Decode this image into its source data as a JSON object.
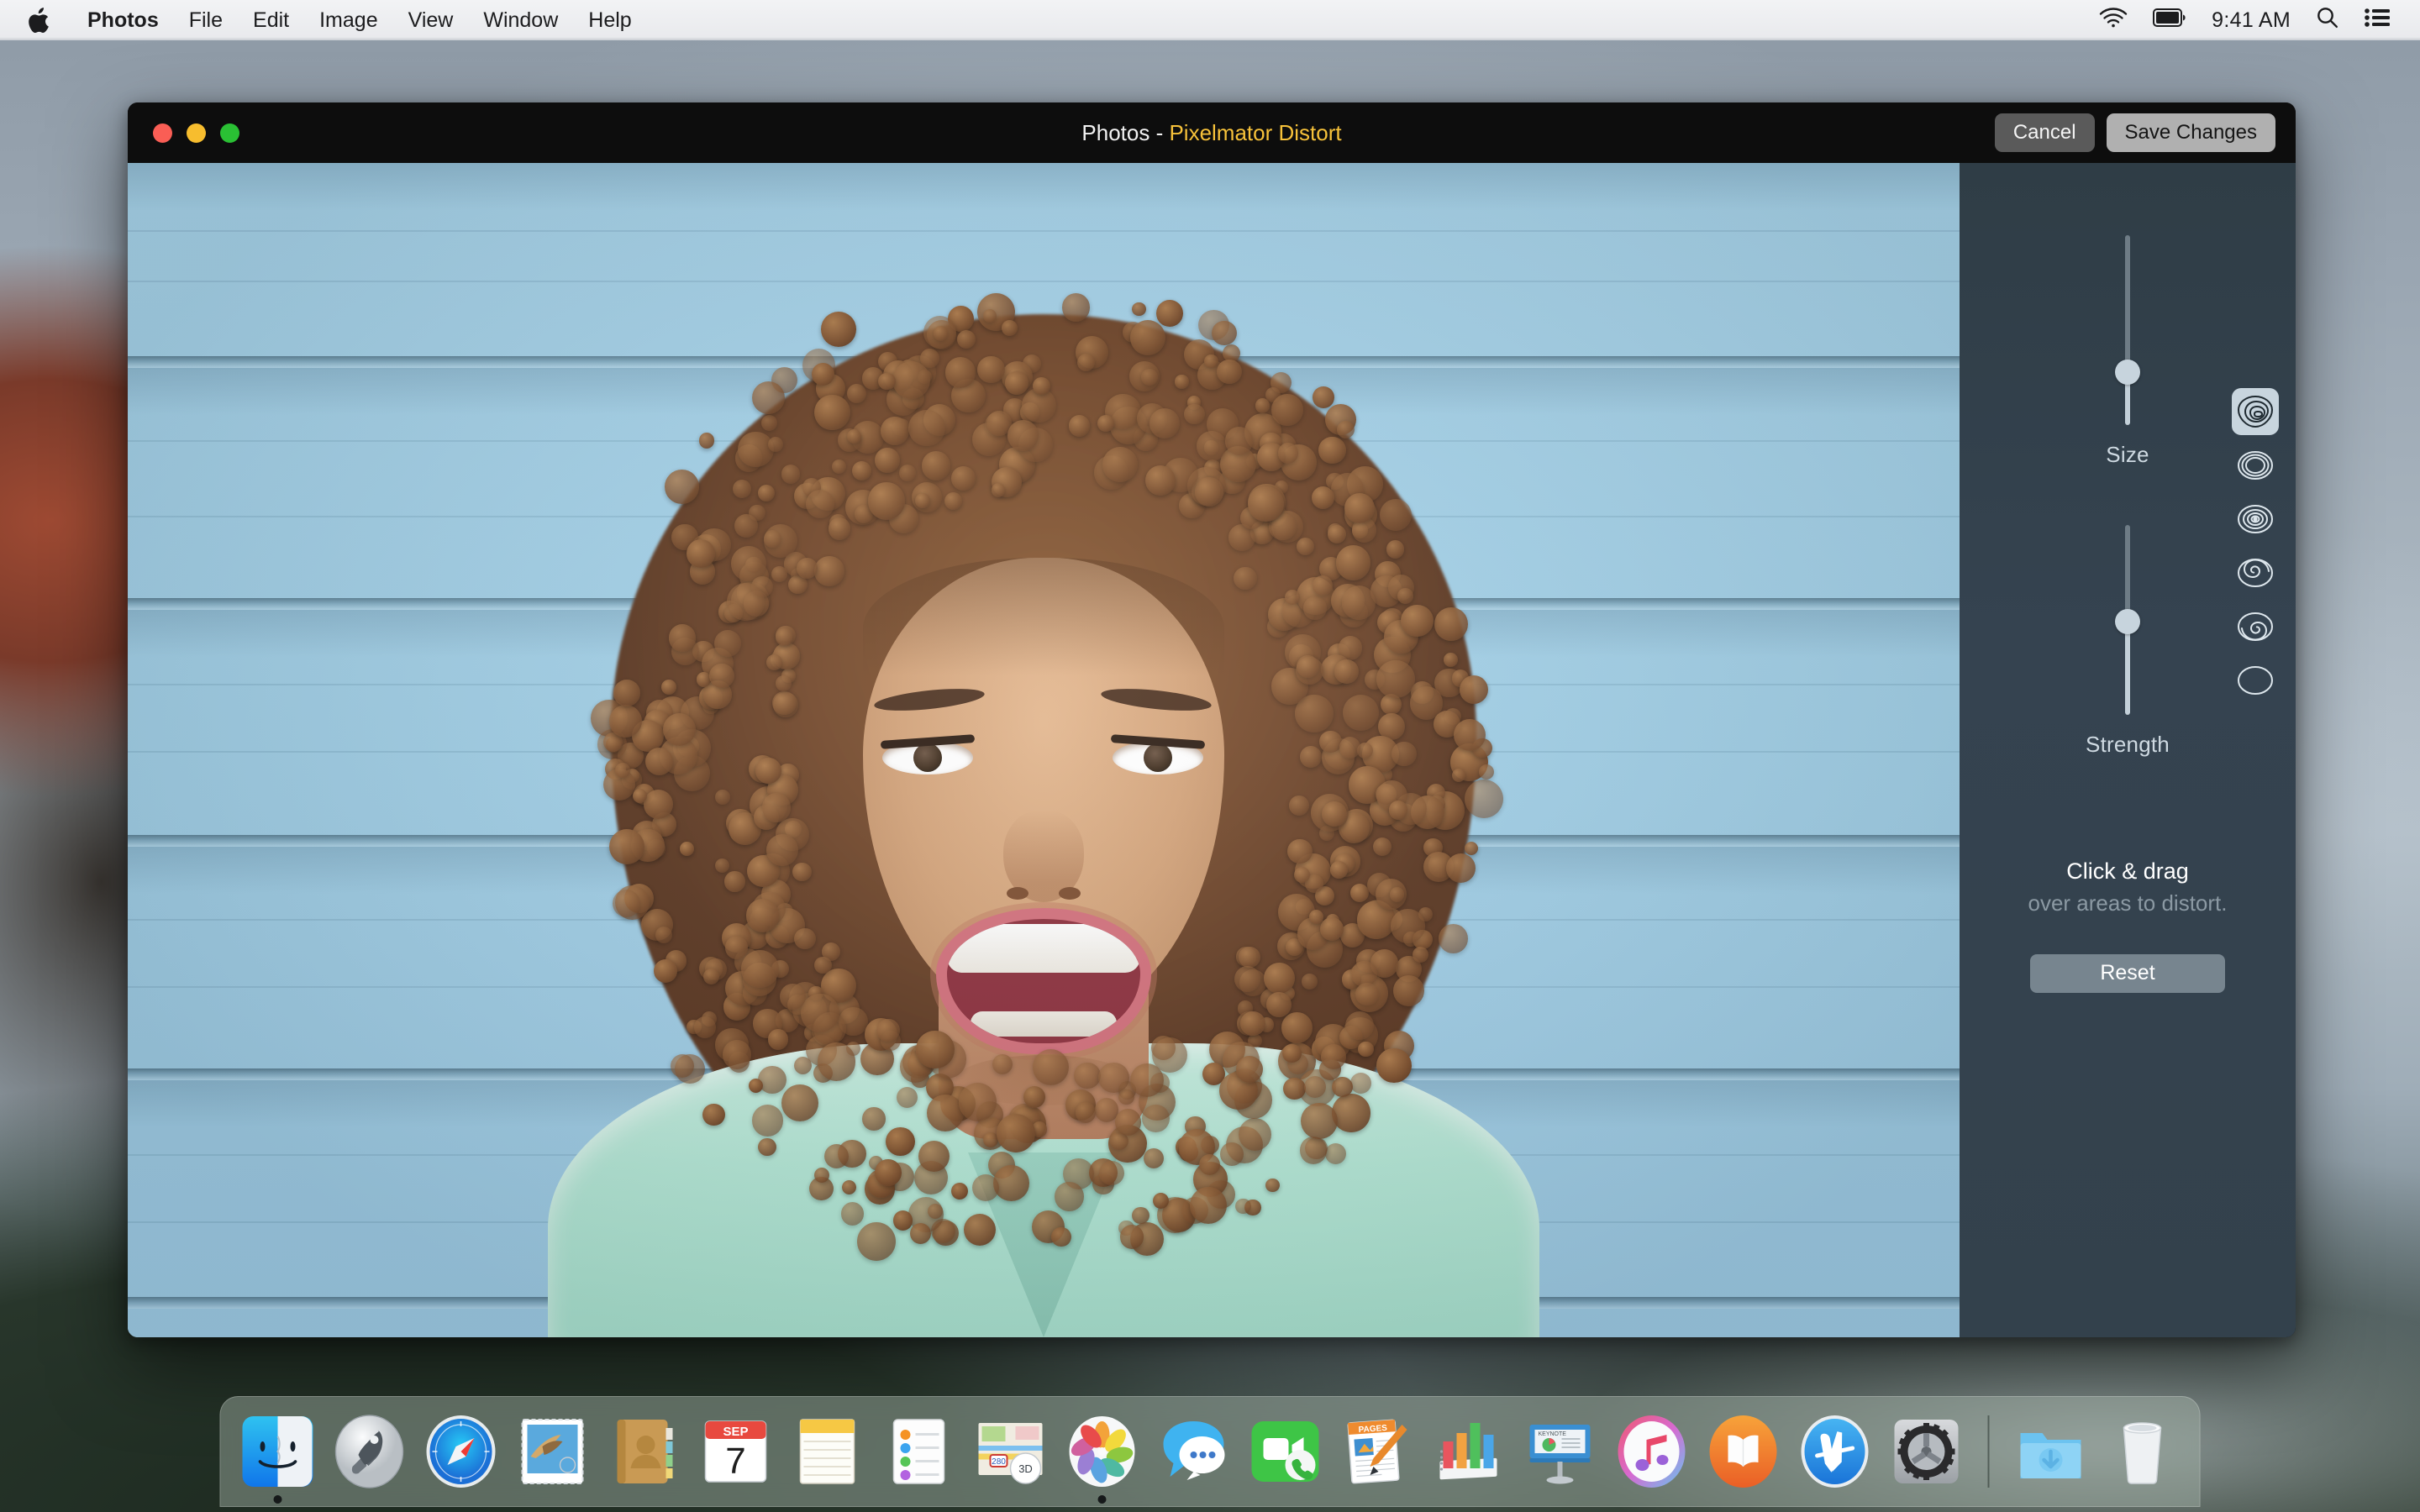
{
  "menubar": {
    "apple_icon": "apple-logo-icon",
    "items": [
      {
        "label": "Photos",
        "bold": true
      },
      {
        "label": "File"
      },
      {
        "label": "Edit"
      },
      {
        "label": "Image"
      },
      {
        "label": "View"
      },
      {
        "label": "Window"
      },
      {
        "label": "Help"
      }
    ],
    "status": {
      "wifi_icon": "wifi-icon",
      "battery_icon": "battery-icon",
      "clock": "9:41 AM",
      "search_icon": "spotlight-search-icon",
      "notifications_icon": "notification-center-icon"
    }
  },
  "window": {
    "title_app": "Photos",
    "title_separator": " - ",
    "title_extension": "Pixelmator Distort",
    "accent_color": "#f7c23a",
    "traffic_lights": {
      "close": "close-window-button",
      "minimize": "minimize-window-button",
      "zoom": "zoom-window-button"
    },
    "cancel_label": "Cancel",
    "save_label": "Save Changes"
  },
  "sidebar": {
    "background_color": "#33414c",
    "sliders": [
      {
        "name": "size",
        "label": "Size",
        "value_pct": 72
      },
      {
        "name": "strength",
        "label": "Strength",
        "value_pct": 51
      }
    ],
    "tools": [
      {
        "name": "warp-tool",
        "icon": "warp-distort-icon",
        "selected": true
      },
      {
        "name": "bump-tool",
        "icon": "bump-rings-icon",
        "selected": false
      },
      {
        "name": "pinch-tool",
        "icon": "concentric-rings-icon",
        "selected": false
      },
      {
        "name": "twirl-left-tool",
        "icon": "swirl-left-icon",
        "selected": false
      },
      {
        "name": "twirl-right-tool",
        "icon": "swirl-right-icon",
        "selected": false
      },
      {
        "name": "restore-tool",
        "icon": "plain-circle-icon",
        "selected": false
      }
    ],
    "hint_main": "Click & drag",
    "hint_sub": "over areas to distort.",
    "reset_label": "Reset"
  },
  "dock": {
    "items": [
      {
        "name": "finder",
        "icon": "finder-icon",
        "running": true
      },
      {
        "name": "launchpad",
        "icon": "launchpad-icon",
        "running": false
      },
      {
        "name": "safari",
        "icon": "safari-compass-icon",
        "running": false
      },
      {
        "name": "mail",
        "icon": "mail-stamp-icon",
        "running": false
      },
      {
        "name": "contacts",
        "icon": "contacts-book-icon",
        "running": false
      },
      {
        "name": "calendar",
        "icon": "calendar-icon",
        "running": false,
        "month": "SEP",
        "day": "7"
      },
      {
        "name": "notes",
        "icon": "notes-pad-icon",
        "running": false
      },
      {
        "name": "reminders",
        "icon": "reminders-list-icon",
        "running": false
      },
      {
        "name": "maps",
        "icon": "maps-icon",
        "running": false,
        "road": "280",
        "badge": "3D"
      },
      {
        "name": "photos",
        "icon": "photos-pinwheel-icon",
        "running": true
      },
      {
        "name": "messages",
        "icon": "messages-bubble-icon",
        "running": false
      },
      {
        "name": "facetime",
        "icon": "facetime-video-icon",
        "running": false
      },
      {
        "name": "pages",
        "icon": "pages-document-icon",
        "running": false,
        "doc_label": "PAGES"
      },
      {
        "name": "numbers",
        "icon": "numbers-chart-icon",
        "running": false
      },
      {
        "name": "keynote",
        "icon": "keynote-podium-icon",
        "running": false,
        "doc_label": "KEYNOTE"
      },
      {
        "name": "itunes",
        "icon": "itunes-note-icon",
        "running": false
      },
      {
        "name": "ibooks",
        "icon": "ibooks-open-book-icon",
        "running": false
      },
      {
        "name": "app-store",
        "icon": "app-store-icon",
        "running": false
      },
      {
        "name": "system-preferences",
        "icon": "gear-icon",
        "running": false
      },
      {
        "name": "downloads",
        "icon": "downloads-folder-icon",
        "running": false
      },
      {
        "name": "trash",
        "icon": "trash-bin-icon",
        "running": false
      }
    ]
  }
}
